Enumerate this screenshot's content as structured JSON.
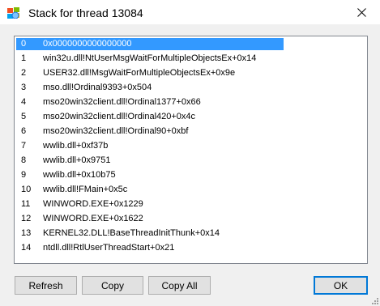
{
  "window": {
    "title": "Stack for thread 13084",
    "icon": "app-icon",
    "close_icon": "close-icon"
  },
  "stack_frames": [
    {
      "index": "0",
      "frame": "0x0000000000000000",
      "selected": true
    },
    {
      "index": "1",
      "frame": "win32u.dll!NtUserMsgWaitForMultipleObjectsEx+0x14"
    },
    {
      "index": "2",
      "frame": "USER32.dll!MsgWaitForMultipleObjectsEx+0x9e"
    },
    {
      "index": "3",
      "frame": "mso.dll!Ordinal9393+0x504"
    },
    {
      "index": "4",
      "frame": "mso20win32client.dll!Ordinal1377+0x66"
    },
    {
      "index": "5",
      "frame": "mso20win32client.dll!Ordinal420+0x4c"
    },
    {
      "index": "6",
      "frame": "mso20win32client.dll!Ordinal90+0xbf"
    },
    {
      "index": "7",
      "frame": "wwlib.dll+0xf37b"
    },
    {
      "index": "8",
      "frame": "wwlib.dll+0x9751"
    },
    {
      "index": "9",
      "frame": "wwlib.dll+0x10b75"
    },
    {
      "index": "10",
      "frame": "wwlib.dll!FMain+0x5c"
    },
    {
      "index": "11",
      "frame": "WINWORD.EXE+0x1229"
    },
    {
      "index": "12",
      "frame": "WINWORD.EXE+0x1622"
    },
    {
      "index": "13",
      "frame": "KERNEL32.DLL!BaseThreadInitThunk+0x14"
    },
    {
      "index": "14",
      "frame": "ntdll.dll!RtlUserThreadStart+0x21"
    }
  ],
  "buttons": {
    "refresh": "Refresh",
    "copy": "Copy",
    "copy_all": "Copy All",
    "ok": "OK"
  },
  "colors": {
    "selection": "#3399ff",
    "default_button_border": "#0078d7"
  }
}
